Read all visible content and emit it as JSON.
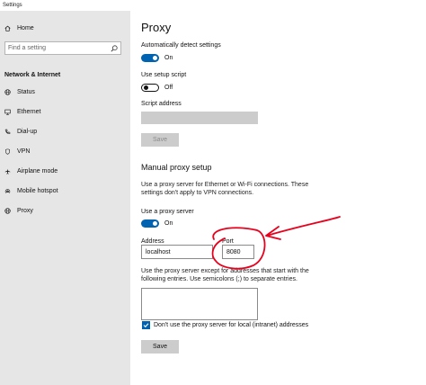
{
  "window": {
    "title": "Settings"
  },
  "sidebar": {
    "home_label": "Home",
    "search_placeholder": "Find a setting",
    "section_title": "Network & Internet",
    "items": [
      {
        "label": "Status",
        "icon": "globe-icon"
      },
      {
        "label": "Ethernet",
        "icon": "monitor-icon"
      },
      {
        "label": "Dial-up",
        "icon": "phone-icon"
      },
      {
        "label": "VPN",
        "icon": "vpn-icon"
      },
      {
        "label": "Airplane mode",
        "icon": "airplane-icon"
      },
      {
        "label": "Mobile hotspot",
        "icon": "hotspot-icon"
      },
      {
        "label": "Proxy",
        "icon": "globe-icon"
      }
    ]
  },
  "main": {
    "title": "Proxy",
    "auto_detect": {
      "label": "Automatically detect settings",
      "state": "On"
    },
    "setup_script": {
      "label": "Use setup script",
      "state": "Off"
    },
    "script_address": {
      "label": "Script address",
      "value": ""
    },
    "save_disabled_label": "Save",
    "manual": {
      "heading": "Manual proxy setup",
      "description": "Use a proxy server for Ethernet or Wi-Fi connections. These settings don't apply to VPN connections.",
      "use_proxy": {
        "label": "Use a proxy server",
        "state": "On"
      },
      "address": {
        "label": "Address",
        "value": "localhost"
      },
      "port": {
        "label": "Port",
        "value": "8080"
      },
      "exceptions_description": "Use the proxy server except for addresses that start with the following entries. Use semicolons (;) to separate entries.",
      "exceptions_value": "",
      "local_checkbox_label": "Don't use the proxy server for local (intranet) addresses",
      "local_checkbox_checked": true,
      "save_label": "Save"
    }
  },
  "colors": {
    "accent": "#0063b1",
    "annotation": "#e8001c"
  }
}
